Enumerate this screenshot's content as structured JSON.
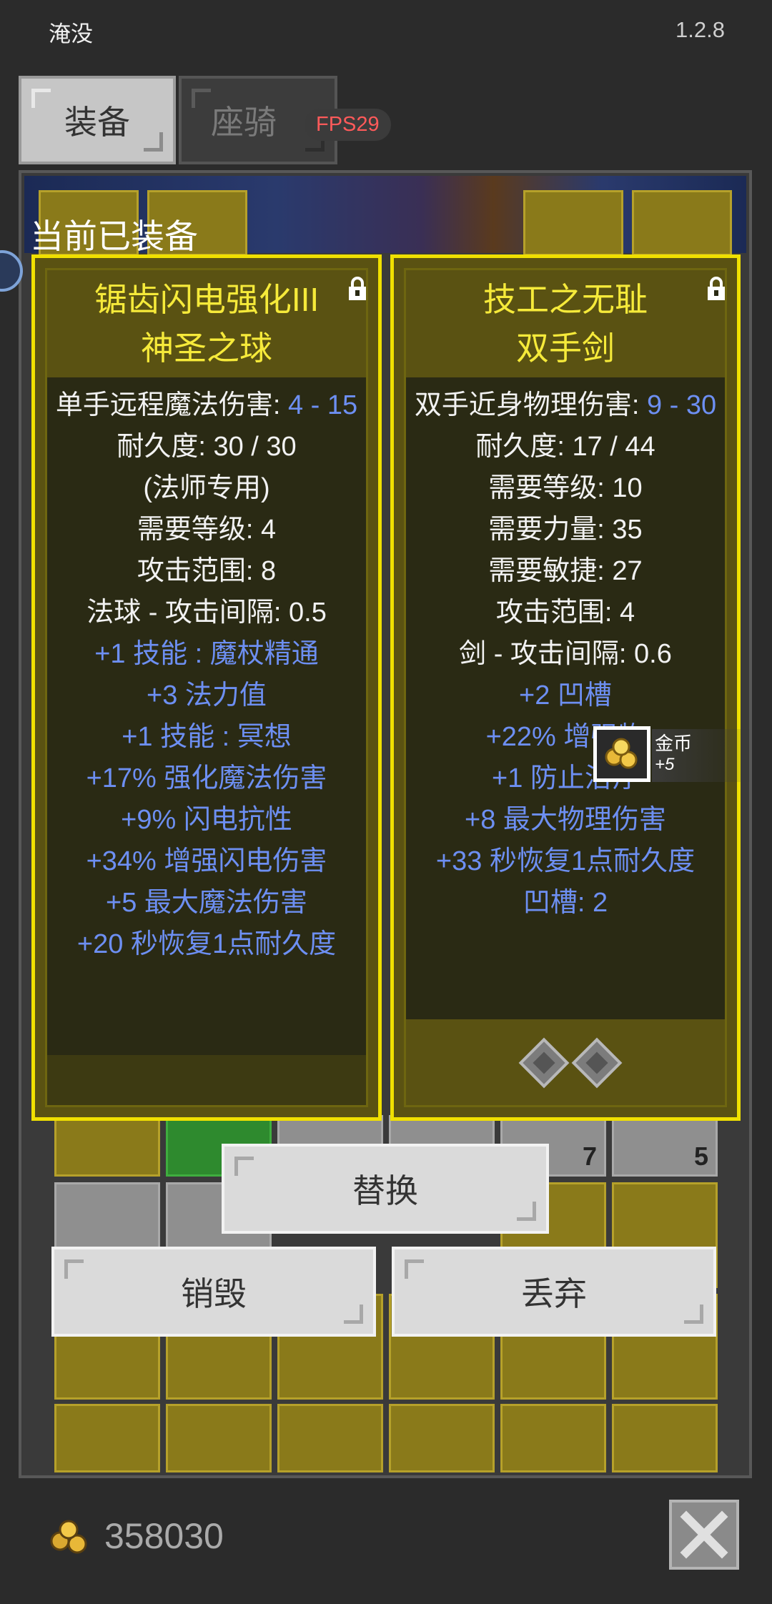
{
  "status": {
    "title": "淹没",
    "version": "1.2.8"
  },
  "tabs": [
    {
      "label": "装备",
      "active": true
    },
    {
      "label": "座骑",
      "active": false
    }
  ],
  "fps": "FPS29",
  "equipped_label": "当前已装备",
  "item_left": {
    "name_line1": "锯齿闪电强化III",
    "name_line2": "神圣之球",
    "stats": [
      {
        "text": "单手远程魔法伤害: ",
        "highlight": "4 - 15"
      },
      {
        "text": "耐久度: 30 / 30"
      },
      {
        "text": "(法师专用)"
      },
      {
        "text": "需要等级: 4"
      },
      {
        "text": "攻击范围: 8"
      },
      {
        "text": "法球 - 攻击间隔: 0.5"
      },
      {
        "blue": "+1 技能 : 魔杖精通"
      },
      {
        "blue": "+3 法力值"
      },
      {
        "blue": "+1 技能 : 冥想"
      },
      {
        "blue": "+17% 强化魔法伤害"
      },
      {
        "blue": "+9% 闪电抗性"
      },
      {
        "blue": "+34% 增强闪电伤害"
      },
      {
        "blue": "+5 最大魔法伤害"
      },
      {
        "blue": "+20 秒恢复1点耐久度"
      }
    ]
  },
  "item_right": {
    "name_line1": "技工之无耻",
    "name_line2": "双手剑",
    "stats": [
      {
        "text": "双手近身物理伤害: ",
        "highlight": "9 - 30"
      },
      {
        "text": "耐久度: 17 / 44"
      },
      {
        "text": "需要等级: 10"
      },
      {
        "text": "需要力量: 35"
      },
      {
        "text": "需要敏捷: 27"
      },
      {
        "text": "攻击范围: 4"
      },
      {
        "text": "剑 - 攻击间隔: 0.6"
      },
      {
        "blue": "+2 凹槽"
      },
      {
        "blue": "+22% 增强物"
      },
      {
        "blue": "+1 防止治疗"
      },
      {
        "blue": "+8 最大物理伤害"
      },
      {
        "blue": "+33 秒恢复1点耐久度"
      },
      {
        "blue": "凹槽: 2"
      }
    ],
    "sockets": 2
  },
  "gold_popup": {
    "name": "金币",
    "amount": "+5"
  },
  "inventory_counts": [
    "7",
    "5"
  ],
  "buttons": {
    "replace": "替换",
    "destroy": "销毁",
    "discard": "丢弃"
  },
  "gold_total": "358030",
  "colors": {
    "card_border": "#f0e000",
    "item_name": "#f6ea3a",
    "magic_blue": "#6d8ff2"
  }
}
